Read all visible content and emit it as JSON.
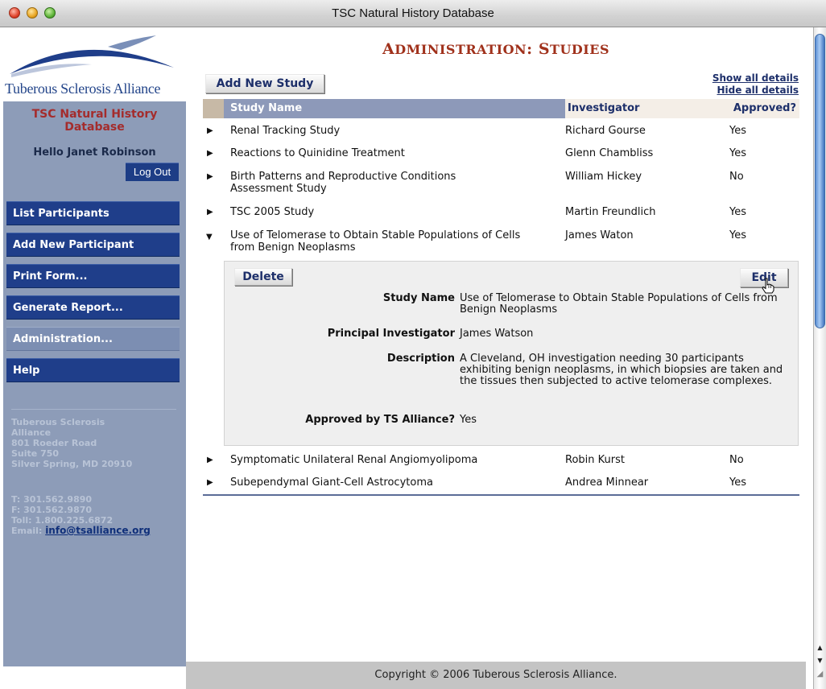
{
  "window": {
    "title": "TSC Natural History Database"
  },
  "sidebar": {
    "logo_text": "Tuberous Sclerosis Alliance",
    "db_title": "TSC Natural History Database",
    "greeting": "Hello Janet Robinson",
    "logout_label": "Log Out",
    "nav": [
      {
        "label": "List Participants",
        "active": false
      },
      {
        "label": "Add New Participant",
        "active": false
      },
      {
        "label": "Print Form...",
        "active": false
      },
      {
        "label": "Generate Report...",
        "active": false
      },
      {
        "label": "Administration...",
        "active": true
      },
      {
        "label": "Help",
        "active": false
      }
    ],
    "address": [
      "Tuberous Sclerosis",
      "Alliance",
      "801 Roeder Road",
      "Suite 750",
      "Silver Spring, MD 20910"
    ],
    "contact": {
      "phone": "T: 301.562.9890",
      "fax": "F: 301.562.9870",
      "tollfree": "Toll: 1.800.225.6872",
      "email_label": "Email:",
      "email": "info@tsalliance.org"
    }
  },
  "main": {
    "title_prefix_big": "A",
    "title_prefix_small": "DMINISTRATION",
    "title_colon": ": ",
    "title_suffix_big": "S",
    "title_suffix_small": "TUDIES",
    "add_study_label": "Add New Study",
    "show_all_label": "Show all details",
    "hide_all_label": "Hide all details",
    "table": {
      "headers": {
        "study": "Study Name",
        "investigator": "Investigator",
        "approved": "Approved?"
      },
      "rows": [
        {
          "name": "Renal Tracking Study",
          "investigator": "Richard Gourse",
          "approved": "Yes",
          "expanded": false
        },
        {
          "name": "Reactions to Quinidine Treatment",
          "investigator": "Glenn Chambliss",
          "approved": "Yes",
          "expanded": false
        },
        {
          "name": "Birth Patterns and Reproductive Conditions Assessment Study",
          "investigator": "William Hickey",
          "approved": "No",
          "expanded": false
        },
        {
          "name": "TSC 2005 Study",
          "investigator": "Martin Freundlich",
          "approved": "Yes",
          "expanded": false
        },
        {
          "name": "Use of Telomerase to Obtain Stable Populations of Cells from Benign Neoplasms",
          "investigator": "James Waton",
          "approved": "Yes",
          "expanded": true
        },
        {
          "name": "Symptomatic Unilateral Renal Angiomyolipoma",
          "investigator": "Robin Kurst",
          "approved": "No",
          "expanded": false
        },
        {
          "name": "Subependymal Giant-Cell Astrocytoma",
          "investigator": "Andrea Minnear",
          "approved": "Yes",
          "expanded": false
        }
      ]
    },
    "detail": {
      "delete_label": "Delete",
      "edit_label": "Edit",
      "study_name_label": "Study Name",
      "study_name": "Use of Telomerase to Obtain Stable Populations of Cells from Benign Neoplasms",
      "pi_label": "Principal Investigator",
      "pi": "James Watson",
      "description_label": "Description",
      "description": "A Cleveland, OH investigation needing 30 participants exhibiting benign neoplasms, in which biopsies are taken and the tissues then subjected to active telomerase complexes.",
      "approved_label": "Approved by TS Alliance?",
      "approved": "Yes"
    }
  },
  "footer": {
    "copyright": "Copyright © 2006 Tuberous Sclerosis Alliance."
  },
  "colors": {
    "sidebar_bg": "#8d9cb8",
    "nav_button": "#1f3e8a",
    "title_red": "#a0311b",
    "header_bg": "#8d99b9",
    "link_navy": "#1d2f6a"
  }
}
